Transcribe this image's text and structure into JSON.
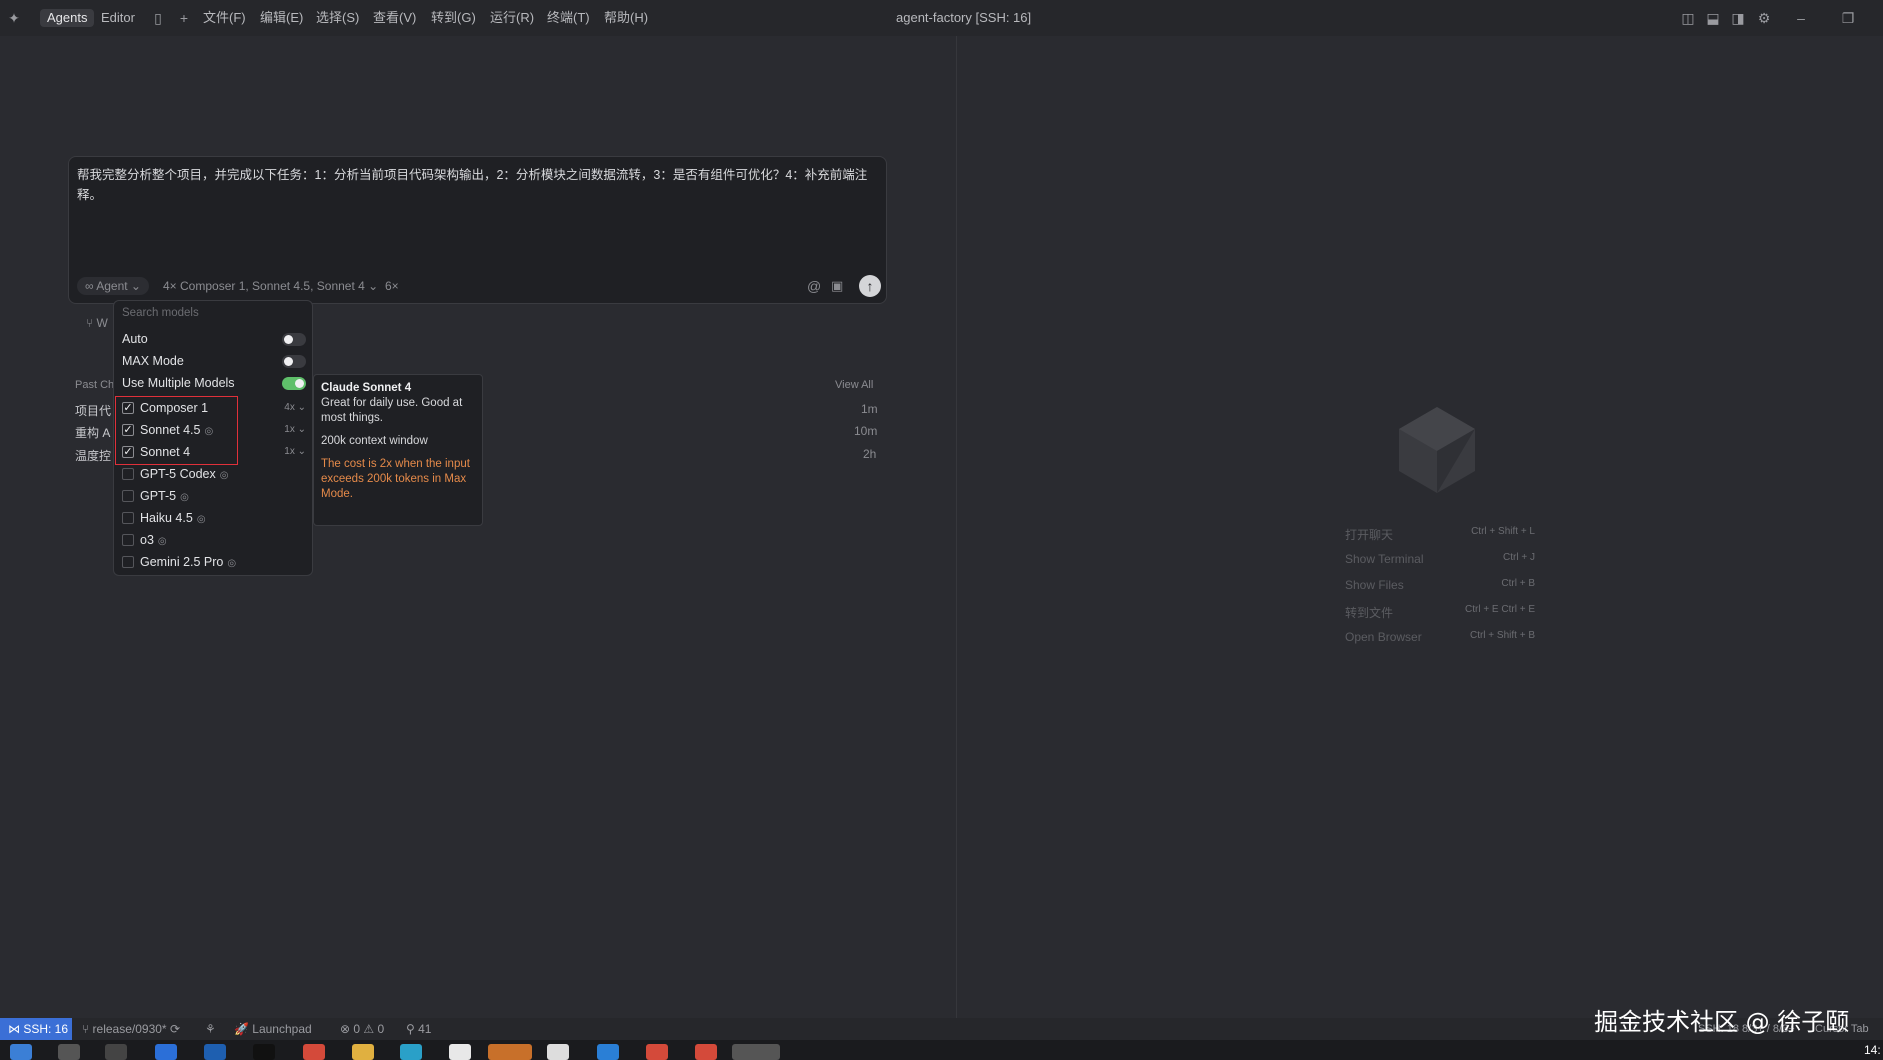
{
  "titlebar": {
    "tab_agents": "Agents",
    "tab_editor": "Editor",
    "menus": [
      "文件(F)",
      "编辑(E)",
      "选择(S)",
      "查看(V)",
      "转到(G)",
      "运行(R)",
      "终端(T)",
      "帮助(H)"
    ],
    "window_title": "agent-factory [SSH: 16]"
  },
  "composer": {
    "text": "帮我完整分析整个项目，并完成以下任务：1：分析当前项目代码架构输出，2：分析模块之间数据流转，3：是否有组件可优化？4：补充前端注释。",
    "agent_label": "Agent",
    "models_summary": "4× Composer 1, Sonnet 4.5, Sonnet 4",
    "total_mult": "6×"
  },
  "past_chats": {
    "header": "Past Ch",
    "view_all": "View All",
    "items": [
      {
        "title": "项目代",
        "time": "1m"
      },
      {
        "title": "重构 A",
        "time": "10m"
      },
      {
        "title": "温度控",
        "time": "2h"
      }
    ],
    "worktree_label": "W"
  },
  "model_dropdown": {
    "search_placeholder": "Search models",
    "toggles": [
      {
        "label": "Auto",
        "on": false
      },
      {
        "label": "MAX Mode",
        "on": false
      },
      {
        "label": "Use Multiple Models",
        "on": true
      }
    ],
    "models": [
      {
        "label": "Composer 1",
        "checked": true,
        "mult": "4x",
        "brain": false
      },
      {
        "label": "Sonnet 4.5",
        "checked": true,
        "mult": "1x",
        "brain": true
      },
      {
        "label": "Sonnet 4",
        "checked": true,
        "mult": "1x",
        "brain": false
      },
      {
        "label": "GPT-5 Codex",
        "checked": false,
        "mult": "",
        "brain": true
      },
      {
        "label": "GPT-5",
        "checked": false,
        "mult": "",
        "brain": true
      },
      {
        "label": "Haiku 4.5",
        "checked": false,
        "mult": "",
        "brain": true
      },
      {
        "label": "o3",
        "checked": false,
        "mult": "",
        "brain": true
      },
      {
        "label": "Gemini 2.5 Pro",
        "checked": false,
        "mult": "",
        "brain": true
      }
    ]
  },
  "tooltip": {
    "title": "Claude Sonnet 4",
    "desc": "Great for daily use. Good at most things.",
    "context": "200k context window",
    "warning": "The cost is 2x when the input exceeds 200k tokens in Max Mode."
  },
  "empty_state": {
    "shortcuts": [
      {
        "label": "打开聊天",
        "keys": "Ctrl + Shift + L"
      },
      {
        "label": "Show Terminal",
        "keys": "Ctrl + J"
      },
      {
        "label": "Show Files",
        "keys": "Ctrl + B"
      },
      {
        "label": "转到文件",
        "keys": "Ctrl + E   Ctrl + E"
      },
      {
        "label": "Open Browser",
        "keys": "Ctrl + Shift + B"
      }
    ]
  },
  "statusbar": {
    "ssh": "SSH: 16",
    "branch": "release/0930*",
    "launchpad": "Launchpad",
    "problems": "0 ⚠ 0",
    "ports": "41",
    "right_text": "SSH: 18 8/3+ / 8/3+",
    "cursor_tab": "Cursor Tab"
  },
  "taskbar": {
    "time": "14:"
  },
  "watermark": "掘金技术社区 @ 徐子颐",
  "colors": {
    "accent": "#3b6fd6",
    "toggle_on": "#5fbf6a",
    "highlight": "#e0303a",
    "warning": "#e58a4a"
  }
}
